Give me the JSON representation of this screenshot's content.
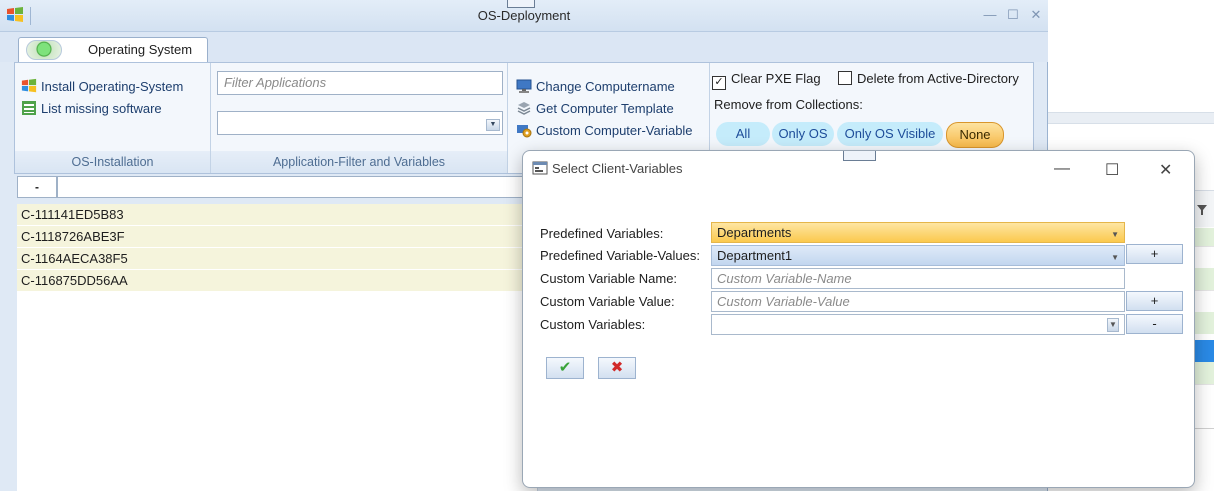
{
  "window": {
    "title": "OS-Deployment",
    "controls": {
      "minimize": "—",
      "maximize": "☐",
      "close": "✕"
    }
  },
  "tabs": [
    {
      "label": "Operating System"
    }
  ],
  "ribbon": {
    "os_installation": {
      "label": "OS-Installation",
      "install_os": "Install Operating-System",
      "list_missing": "List missing software"
    },
    "app_filter": {
      "label": "Application-Filter and Variables",
      "filter_placeholder": "Filter Applications",
      "combo_value": ""
    },
    "computer": {
      "change_name": "Change Computername",
      "get_template": "Get Computer Template",
      "custom_variable": "Custom Computer-Variable"
    },
    "pxe": {
      "clear_pxe": "Clear PXE Flag",
      "clear_pxe_checked": true,
      "delete_ad": "Delete from Active-Directory",
      "delete_ad_checked": false,
      "remove_label": "Remove from Collections:",
      "pills": [
        "All",
        "Only OS",
        "Only OS Visible",
        "None"
      ],
      "selected_pill": "None"
    }
  },
  "collapse_label": "-",
  "computers": [
    "C-111141ED5B83",
    "C-1118726ABE3F",
    "C-1164AECA38F5",
    "C-116875DD56AA"
  ],
  "dialog": {
    "title": "Select Client-Variables",
    "controls": {
      "minimize": "—",
      "maximize": "☐",
      "close": "✕"
    },
    "labels": {
      "predefined_vars": "Predefined Variables:",
      "predefined_values": "Predefined Variable-Values:",
      "custom_name": "Custom Variable Name:",
      "custom_value": "Custom Variable Value:",
      "custom_vars": "Custom Variables:"
    },
    "predefined_vars_value": "Departments",
    "predefined_values_value": "Department1",
    "custom_name_placeholder": "Custom Variable-Name",
    "custom_value_placeholder": "Custom Variable-Value",
    "custom_vars_value": "",
    "buttons": {
      "add_value": "+",
      "add_custom": "+",
      "remove_custom": "-",
      "ok": "✔",
      "cancel": "✖"
    }
  },
  "colors": {
    "accent_orange": "#fbc94e",
    "pill_blue": "#c5ecfb",
    "selected_row_blue": "#2a8ae6",
    "list_row": "#f5f4dc"
  },
  "icons": {
    "app": "windows-logo-icon",
    "install_os": "windows-logo-icon",
    "list_missing": "spreadsheet-icon",
    "change_name": "computer-icon",
    "get_template": "stack-icon",
    "custom_variable": "gear-computer-icon",
    "dialog": "window-icon",
    "ok": "checkmark-icon",
    "cancel": "cross-icon"
  }
}
